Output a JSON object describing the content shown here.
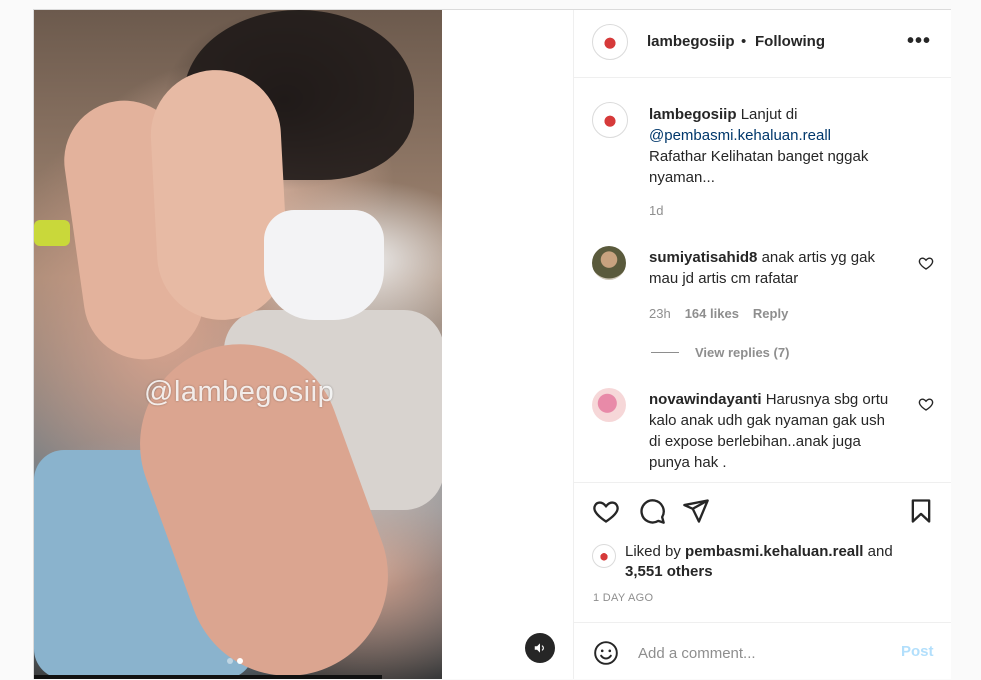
{
  "media": {
    "watermark": "@lambegosiip",
    "carousel_dots": 2,
    "active_dot": 1
  },
  "header": {
    "username": "lambegosiip",
    "separator": "•",
    "follow_status": "Following",
    "more": "•••"
  },
  "caption": {
    "username": "lambegosiip",
    "text_prefix": "Lanjut di",
    "mention": "@pembasmi.kehaluan.reall",
    "text": "Rafathar Kelihatan banget nggak nyaman...",
    "time": "1d"
  },
  "comments": [
    {
      "username": "sumiyatisahid8",
      "text": "anak artis yg gak mau jd artis cm rafatar",
      "time": "23h",
      "likes": "164 likes",
      "reply": "Reply",
      "view_replies": "View replies (7)"
    },
    {
      "username": "novawindayanti",
      "text": "Harusnya sbg ortu kalo anak udh gak nyaman gak ush di expose berlebihan..anak juga punya hak ."
    }
  ],
  "likes": {
    "prefix": "Liked by",
    "user": "pembasmi.kehaluan.reall",
    "conjunction": "and",
    "others": "3,551 others"
  },
  "timestamp": "1 DAY AGO",
  "add_comment": {
    "placeholder": "Add a comment...",
    "post_label": "Post"
  },
  "colors": {
    "text": "#262626",
    "muted": "#8e8e8e",
    "mention": "#00376b",
    "post_disabled": "#b2dffc",
    "border": "#efefef"
  }
}
